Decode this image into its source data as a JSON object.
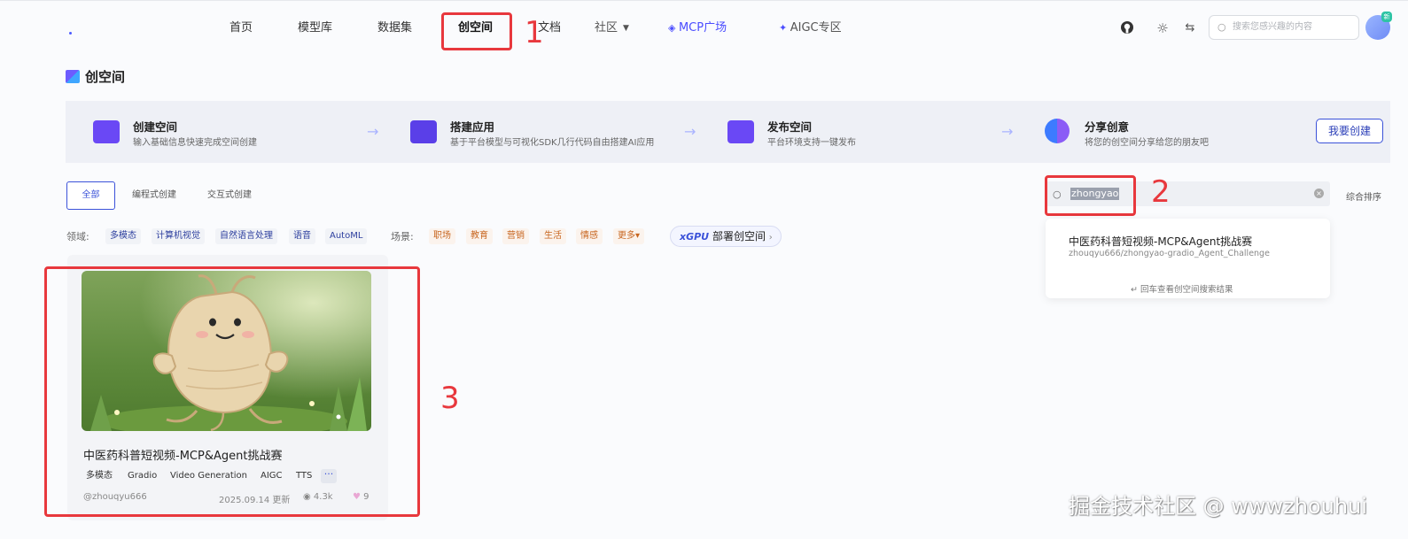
{
  "nav": {
    "items": [
      "首页",
      "模型库",
      "数据集",
      "创空间",
      "文档",
      "社区",
      "MCP广场",
      "AIGC专区"
    ],
    "search_placeholder": "搜索您感兴趣的内容"
  },
  "annotations": {
    "n1": "1",
    "n2": "2",
    "n3": "3"
  },
  "page_title": "创空间",
  "steps": [
    {
      "title": "创建空间",
      "desc": "输入基础信息快速完成空间创建"
    },
    {
      "title": "搭建应用",
      "desc": "基于平台模型与可视化SDK几行代码自由搭建AI应用"
    },
    {
      "title": "发布空间",
      "desc": "平台环境支持一键发布"
    },
    {
      "title": "分享创意",
      "desc": "将您的创空间分享给您的朋友吧"
    }
  ],
  "create_button": "我要创建",
  "tabs": [
    "全部",
    "编程式创建",
    "交互式创建"
  ],
  "filters": {
    "domain_label": "领域:",
    "domain_tags": [
      "多模态",
      "计算机视觉",
      "自然语言处理",
      "语音",
      "AutoML"
    ],
    "scene_label": "场景:",
    "scene_tags": [
      "职场",
      "教育",
      "营销",
      "生活",
      "情感",
      "更多▾"
    ],
    "gpu_prefix": "xGPU",
    "gpu_label": "部署创空间"
  },
  "card": {
    "title": "中医药科普短视频-MCP&Agent挑战赛",
    "tags": [
      "多模态",
      "Gradio",
      "Video Generation",
      "AIGC",
      "TTS"
    ],
    "more": "···",
    "author": "@zhouqyu666",
    "updated": "2025.09.14 更新",
    "views": "4.3k",
    "likes": "9"
  },
  "search": {
    "value": "zhongyao",
    "sort_label": "综合排序",
    "result_title": "中医药科普短视频-MCP&Agent挑战赛",
    "result_path": "zhouqyu666/zhongyao-gradio_Agent_Challenge",
    "enter_hint": "回车查看创空间搜索结果"
  },
  "watermark": "掘金技术社区 @ wwwzhouhui",
  "colors": {
    "accent": "#3b52d9",
    "annotation": "#e8383d",
    "banner_bg": "#eef0f6"
  }
}
